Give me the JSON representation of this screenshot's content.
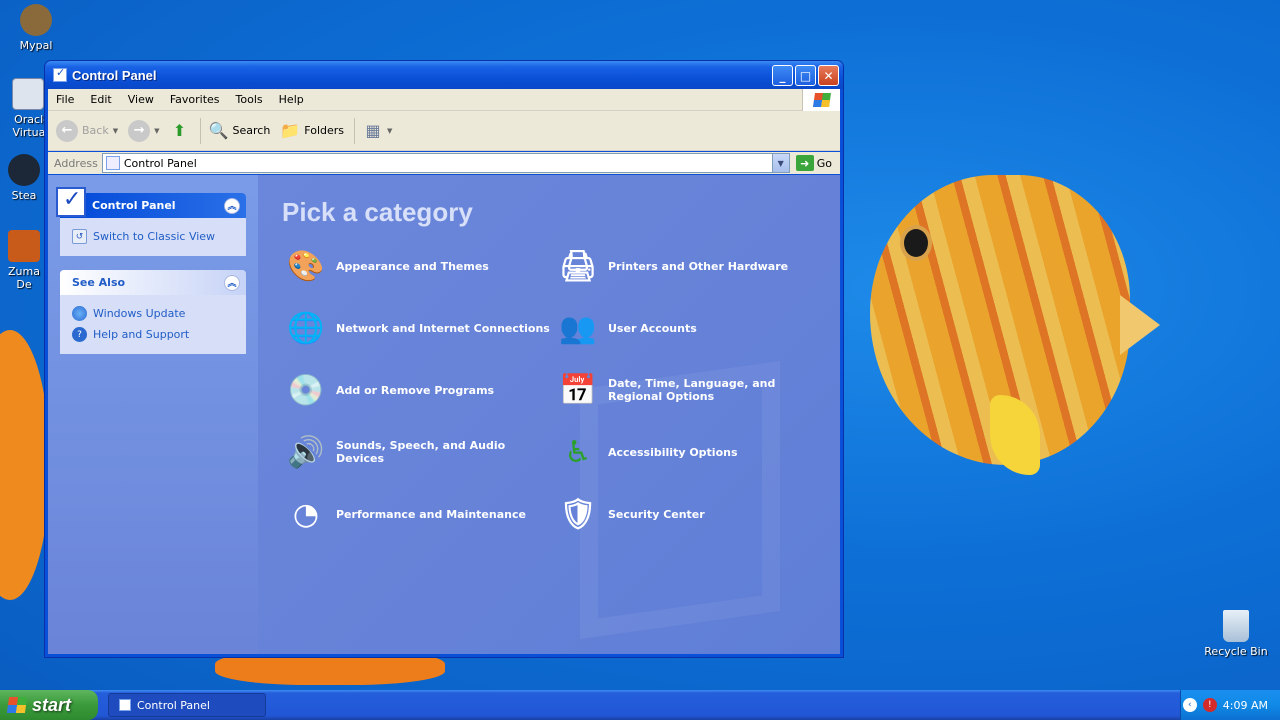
{
  "desktop": {
    "icons": [
      {
        "label": "Mypal"
      },
      {
        "label": "Oracle Virtuall"
      },
      {
        "label": "Stea"
      },
      {
        "label": "Zuma De"
      },
      {
        "label": "Recycle Bin"
      }
    ]
  },
  "window": {
    "title": "Control Panel",
    "menu": [
      "File",
      "Edit",
      "View",
      "Favorites",
      "Tools",
      "Help"
    ],
    "toolbar": {
      "back": "Back",
      "search": "Search",
      "folders": "Folders"
    },
    "address": {
      "label": "Address",
      "value": "Control Panel",
      "go": "Go"
    }
  },
  "sidebar": {
    "control_panel": {
      "title": "Control Panel",
      "switch_link": "Switch to Classic View"
    },
    "see_also": {
      "title": "See Also",
      "links": [
        "Windows Update",
        "Help and Support"
      ]
    }
  },
  "main": {
    "heading": "Pick a category",
    "categories": [
      {
        "label": "Appearance and Themes",
        "icon": "appearance-icon"
      },
      {
        "label": "Printers and Other Hardware",
        "icon": "printer-icon"
      },
      {
        "label": "Network and Internet Connections",
        "icon": "network-icon"
      },
      {
        "label": "User Accounts",
        "icon": "users-icon"
      },
      {
        "label": "Add or Remove Programs",
        "icon": "programs-icon"
      },
      {
        "label": "Date, Time, Language, and Regional Options",
        "icon": "datetime-icon"
      },
      {
        "label": "Sounds, Speech, and Audio Devices",
        "icon": "sound-icon"
      },
      {
        "label": "Accessibility Options",
        "icon": "accessibility-icon"
      },
      {
        "label": "Performance and Maintenance",
        "icon": "performance-icon"
      },
      {
        "label": "Security Center",
        "icon": "security-shield-icon"
      }
    ]
  },
  "taskbar": {
    "start": "start",
    "task": "Control Panel",
    "clock": "4:09 AM"
  },
  "colors": {
    "xp_blue": "#0a4fd8",
    "pane_link": "#215dc6",
    "start_green": "#3a9a3a"
  }
}
